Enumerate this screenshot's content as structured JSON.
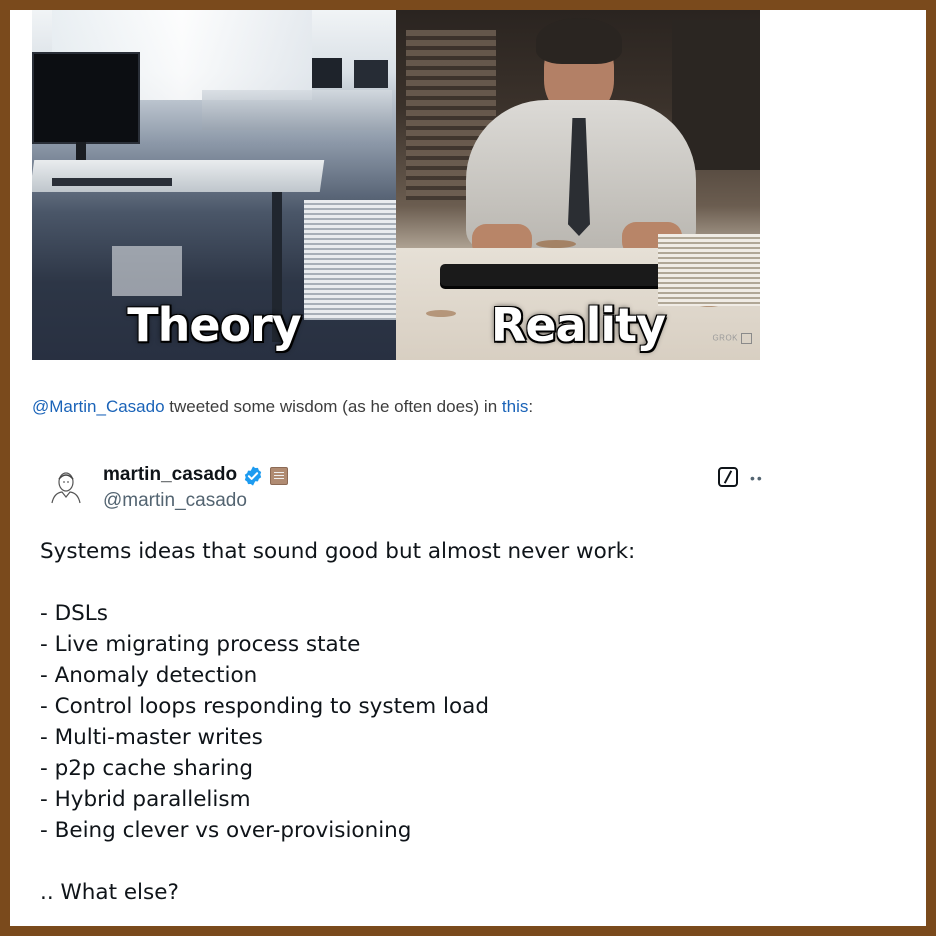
{
  "hero": {
    "left_caption": "Theory",
    "right_caption": "Reality",
    "watermark": "GROK"
  },
  "intro": {
    "mention": "@Martin_Casado",
    "text_middle": " tweeted some wisdom (as he often does) in ",
    "link": "this",
    "text_end": ":"
  },
  "tweet": {
    "display_name": "martin_casado",
    "handle": "@martin_casado",
    "icons": [
      "avatar",
      "verified-icon",
      "affiliate-badge-icon",
      "grok-icon",
      "more-icon"
    ],
    "lines": [
      "Systems ideas that sound good but almost never work:",
      "",
      "- DSLs",
      "- Live migrating process state",
      "- Anomaly detection",
      "- Control loops responding to system load",
      "- Multi-master writes",
      "- p2p cache sharing",
      "- Hybrid parallelism",
      "- Being clever vs over-provisioning",
      "",
      ".. What else?"
    ]
  },
  "colors": {
    "frame": "#7a4a1c",
    "link": "#1a63b8",
    "verified": "#1d9bf0"
  }
}
